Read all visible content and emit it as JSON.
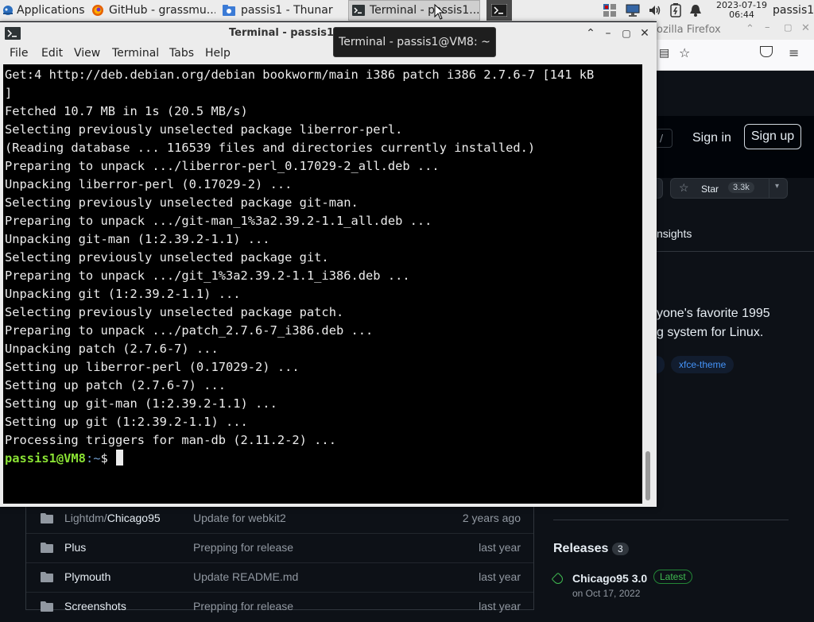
{
  "panel": {
    "applications_label": "Applications",
    "tasks": [
      {
        "label": "GitHub - grassmu..."
      },
      {
        "label": "passis1 - Thunar"
      },
      {
        "label": "Terminal - passis1..."
      }
    ],
    "clock_date": "2023-07-19",
    "clock_time": "06:44",
    "user": "passis1"
  },
  "terminal": {
    "window_title": "Terminal - passis1@VM8: ~",
    "tooltip": "Terminal - passis1@VM8: ~",
    "menu": [
      "File",
      "Edit",
      "View",
      "Terminal",
      "Tabs",
      "Help"
    ],
    "lines": [
      "Get:4 http://deb.debian.org/debian bookworm/main i386 patch i386 2.7.6-7 [141 kB",
      "]",
      "Fetched 10.7 MB in 1s (20.5 MB/s)",
      "Selecting previously unselected package liberror-perl.",
      "(Reading database ... 116539 files and directories currently installed.)",
      "Preparing to unpack .../liberror-perl_0.17029-2_all.deb ...",
      "Unpacking liberror-perl (0.17029-2) ...",
      "Selecting previously unselected package git-man.",
      "Preparing to unpack .../git-man_1%3a2.39.2-1.1_all.deb ...",
      "Unpacking git-man (1:2.39.2-1.1) ...",
      "Selecting previously unselected package git.",
      "Preparing to unpack .../git_1%3a2.39.2-1.1_i386.deb ...",
      "Unpacking git (1:2.39.2-1.1) ...",
      "Selecting previously unselected package patch.",
      "Preparing to unpack .../patch_2.7.6-7_i386.deb ...",
      "Unpacking patch (2.7.6-7) ...",
      "Setting up liberror-perl (0.17029-2) ...",
      "Setting up patch (2.7.6-7) ...",
      "Setting up git-man (1:2.39.2-1.1) ...",
      "Setting up git (1:2.39.2-1.1) ...",
      "Processing triggers for man-db (2.11.2-2) ..."
    ],
    "prompt_user": "passis1@VM8",
    "prompt_path": ":~",
    "prompt_sign": "$ "
  },
  "firefox": {
    "title_fragment": "ozilla Firefox",
    "sign_in": "Sign in",
    "sign_up": "Sign up",
    "search_key": "/",
    "star_label": "Star",
    "star_count": "3.3k",
    "insights_tab": "nsights",
    "about_line1": "yone's favorite 1995",
    "about_line2": "g system for Linux.",
    "topic": "xfce-theme",
    "releases_label": "Releases",
    "releases_count": "3",
    "release_name": "Chicago95 3.0",
    "release_badge": "Latest",
    "release_date": "on Oct 17, 2022"
  },
  "files": [
    {
      "dir": "Lightdm/",
      "name": "Chicago95",
      "message": "Update for webkit2",
      "time": "2 years ago"
    },
    {
      "dir": "",
      "name": "Plus",
      "message": "Prepping for release",
      "time": "last year"
    },
    {
      "dir": "",
      "name": "Plymouth",
      "message": "Update README.md",
      "time": "last year"
    },
    {
      "dir": "",
      "name": "Screenshots",
      "message": "Prepping for release",
      "time": "last year"
    }
  ]
}
